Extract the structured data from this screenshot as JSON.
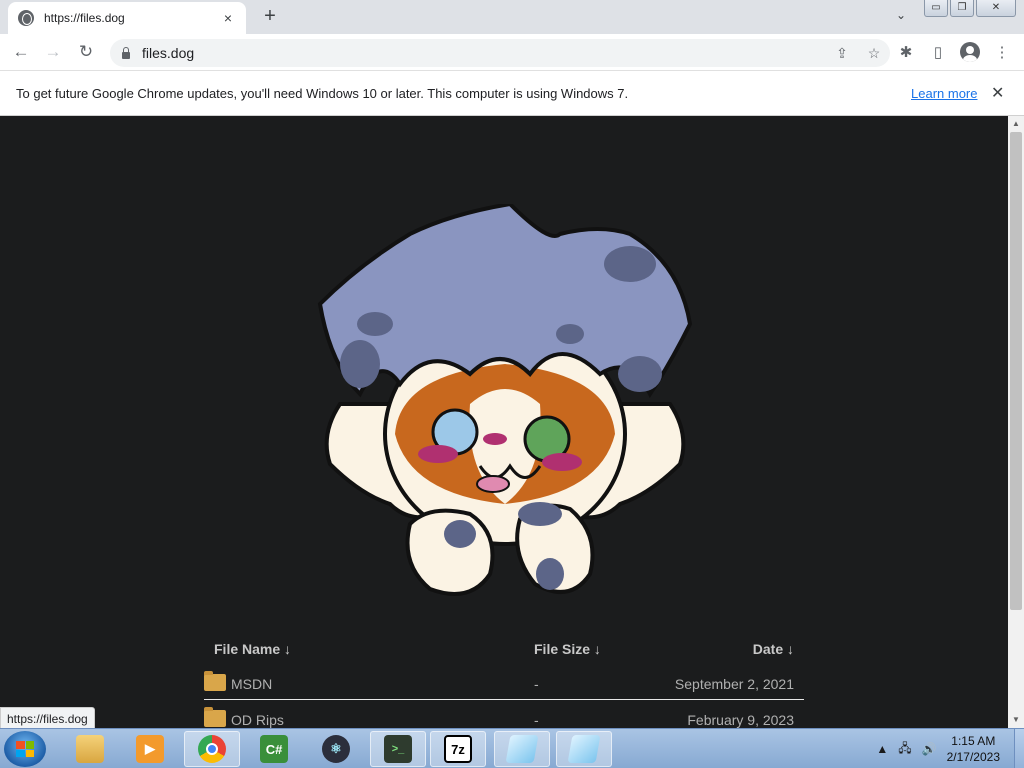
{
  "browser": {
    "tab": {
      "title": "https://files.dog",
      "close_icon": "×"
    },
    "new_tab": "+",
    "tab_search_icon": "⌄",
    "window_controls": {
      "minimize": "▭",
      "restore": "❐",
      "close": "✕"
    },
    "nav": {
      "back": "←",
      "forward": "→",
      "reload": "↻"
    },
    "address": {
      "url": "files.dog"
    },
    "omnibox_icons": {
      "share": "⇪",
      "bookmark": "☆"
    },
    "toolbar_icons": {
      "extensions": "✱",
      "side_panel": "▯",
      "menu": "⋮"
    }
  },
  "infobar": {
    "message": "To get future Google Chrome updates, you'll need Windows 10 or later. This computer is using Windows 7.",
    "link": "Learn more",
    "close": "✕"
  },
  "file_list": {
    "headers": {
      "name": "File Name  ↓",
      "size": "File Size  ↓",
      "date": "Date  ↓"
    },
    "rows": [
      {
        "name": "MSDN",
        "size": "-",
        "date": "September 2, 2021"
      },
      {
        "name": "OD Rips",
        "size": "-",
        "date": "February 9, 2023"
      }
    ]
  },
  "status_url": "https://files.dog",
  "scrollbar": {
    "up": "▲",
    "down": "▼"
  },
  "taskbar": {
    "apps": [
      {
        "name": "explorer",
        "label": ""
      },
      {
        "name": "media-player",
        "label": "▶"
      },
      {
        "name": "chrome",
        "label": ""
      },
      {
        "name": "csharp-editor",
        "label": "C#"
      },
      {
        "name": "electron-app",
        "label": "⚛"
      },
      {
        "name": "terminal",
        "label": ">_"
      },
      {
        "name": "7zip",
        "label": "7z"
      },
      {
        "name": "notepad-1",
        "label": ""
      },
      {
        "name": "notepad-2",
        "label": ""
      }
    ],
    "tray": {
      "arrow": "▲",
      "network": "🖧",
      "volume": "🔊"
    },
    "clock": {
      "time": "1:15 AM",
      "date": "2/17/2023"
    }
  },
  "colors": {
    "page_bg": "#1b1c1d",
    "link": "#1a73e8",
    "folder": "#d9a64a"
  }
}
